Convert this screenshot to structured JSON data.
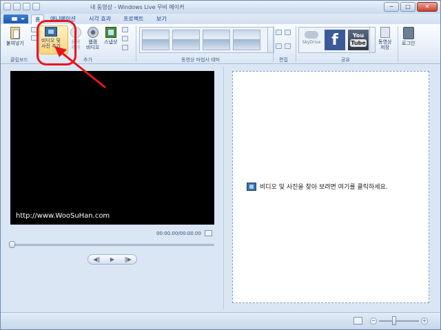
{
  "window": {
    "title": "내 동영상 - Windows Live 무비 메이커",
    "controls": {
      "minimize": "─",
      "maximize": "□",
      "close": "✕"
    }
  },
  "tabs": [
    "홈",
    "애니메이션",
    "시각 효과",
    "프로젝트",
    "보기"
  ],
  "ribbon": {
    "clipboard": {
      "paste": "붙여넣기",
      "group": "클립보드"
    },
    "add": {
      "add_media": [
        "비디오 및",
        "사진 추가"
      ],
      "add_music": [
        "음악",
        "추가"
      ],
      "webcam": [
        "웹캠",
        "비디오"
      ],
      "snapshot": "스냅샷",
      "group": "추가"
    },
    "themes": {
      "group": "동영상 마법사 테마"
    },
    "editing": {
      "group": "편집"
    },
    "sharing": {
      "skydrive": "SkyDrive",
      "facebook": "f",
      "youtube": [
        "You",
        "Tube"
      ],
      "save_movie": [
        "동영상",
        "저장"
      ],
      "group": "공유"
    },
    "signin": "로그인"
  },
  "preview": {
    "watermark": "http://www.WooSuHan.com",
    "time": "00:00.00/00:00.00",
    "transport": {
      "prev": "◀‖",
      "play": "▶",
      "next": "‖▶"
    }
  },
  "storyboard": {
    "hint": "비디오 및 사진을 찾아 보려면 여기를 클릭하세요."
  },
  "statusbar": {
    "zoom_minus": "−",
    "zoom_plus": "+"
  },
  "colors": {
    "annotation": "#e8141d",
    "accent": "#1d58ad"
  }
}
